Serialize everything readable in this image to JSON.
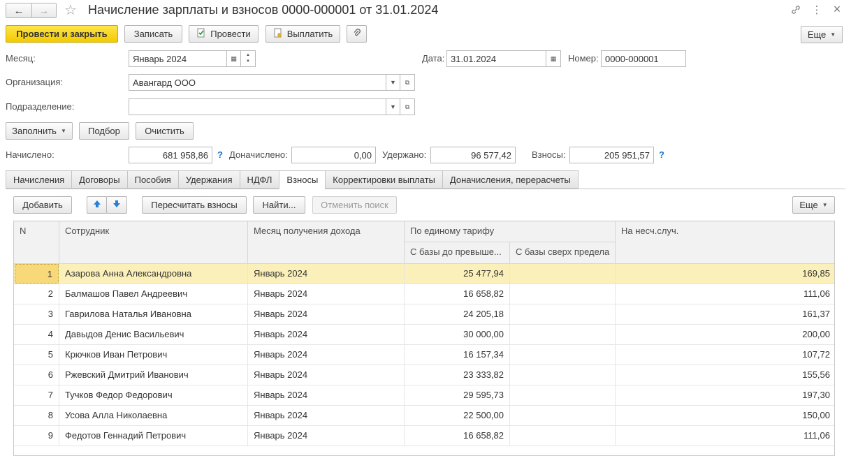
{
  "window": {
    "title": "Начисление зарплаты и взносов 0000-000001 от 31.01.2024",
    "back_icon": "←",
    "forward_icon": "→",
    "star_icon": "☆",
    "link_icon": "🔗",
    "menu_icon": "⋮",
    "close_icon": "×"
  },
  "toolbar": {
    "post_close": "Провести и закрыть",
    "save": "Записать",
    "post": "Провести",
    "pay": "Выплатить",
    "attach_icon": "📎",
    "more": "Еще"
  },
  "form": {
    "month_label": "Месяц:",
    "month_value": "Январь 2024",
    "date_label": "Дата:",
    "date_value": "31.01.2024",
    "number_label": "Номер:",
    "number_value": "0000-000001",
    "org_label": "Организация:",
    "org_value": "Авангард ООО",
    "dept_label": "Подразделение:",
    "dept_value": ""
  },
  "actions": {
    "fill": "Заполнить",
    "select": "Подбор",
    "clear": "Очистить"
  },
  "totals": {
    "accrued_label": "Начислено:",
    "accrued_value": "681 958,86",
    "extra_label": "Доначислено:",
    "extra_value": "0,00",
    "withheld_label": "Удержано:",
    "withheld_value": "96 577,42",
    "contrib_label": "Взносы:",
    "contrib_value": "205 951,57",
    "help": "?"
  },
  "tabs": [
    "Начисления",
    "Договоры",
    "Пособия",
    "Удержания",
    "НДФЛ",
    "Взносы",
    "Корректировки выплаты",
    "Доначисления, перерасчеты"
  ],
  "table_toolbar": {
    "add": "Добавить",
    "recalc": "Пересчитать взносы",
    "find": "Найти...",
    "cancel_search": "Отменить поиск",
    "more": "Еще"
  },
  "table": {
    "headers": {
      "n": "N",
      "employee": "Сотрудник",
      "month": "Месяц получения дохода",
      "tariff_group": "По единому тарифу",
      "base_below": "С базы до превыше...",
      "base_above": "С базы сверх предела",
      "accident": "На несч.случ."
    },
    "rows": [
      {
        "n": "1",
        "employee": "Азарова Анна Александровна",
        "month": "Январь 2024",
        "base_below": "25 477,94",
        "base_above": "",
        "accident": "169,85"
      },
      {
        "n": "2",
        "employee": "Балмашов Павел Андреевич",
        "month": "Январь 2024",
        "base_below": "16 658,82",
        "base_above": "",
        "accident": "111,06"
      },
      {
        "n": "3",
        "employee": "Гаврилова Наталья Ивановна",
        "month": "Январь 2024",
        "base_below": "24 205,18",
        "base_above": "",
        "accident": "161,37"
      },
      {
        "n": "4",
        "employee": "Давыдов Денис Васильевич",
        "month": "Январь 2024",
        "base_below": "30 000,00",
        "base_above": "",
        "accident": "200,00"
      },
      {
        "n": "5",
        "employee": "Крючков Иван Петрович",
        "month": "Январь 2024",
        "base_below": "16 157,34",
        "base_above": "",
        "accident": "107,72"
      },
      {
        "n": "6",
        "employee": "Ржевский Дмитрий Иванович",
        "month": "Январь 2024",
        "base_below": "23 333,82",
        "base_above": "",
        "accident": "155,56"
      },
      {
        "n": "7",
        "employee": "Тучков Федор Федорович",
        "month": "Январь 2024",
        "base_below": "29 595,73",
        "base_above": "",
        "accident": "197,30"
      },
      {
        "n": "8",
        "employee": "Усова Алла Николаевна",
        "month": "Январь 2024",
        "base_below": "22 500,00",
        "base_above": "",
        "accident": "150,00"
      },
      {
        "n": "9",
        "employee": "Федотов Геннадий Петрович",
        "month": "Январь 2024",
        "base_below": "16 658,82",
        "base_above": "",
        "accident": "111,06"
      }
    ]
  }
}
